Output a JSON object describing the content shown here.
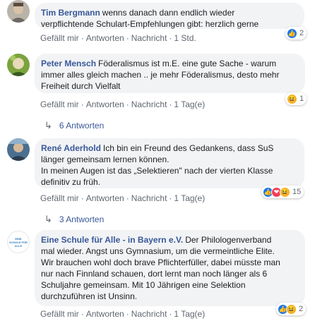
{
  "comments": [
    {
      "author": "Tim Bergmann",
      "lines": [
        "wenns danach dann endlich wieder",
        "verpflichtende Schulart-Empfehlungen gibt: herzlich gerne"
      ],
      "actions": {
        "like": "Gefällt mir",
        "reply": "Antworten",
        "message": "Nachricht",
        "time": "1 Std."
      },
      "reactions": {
        "count": "2"
      }
    },
    {
      "author": "Peter Mensch",
      "lines": [
        "Föderalismus ist m.E. eine gute Sache - warum",
        "immer alles gleich machen .. je mehr Föderalismus, desto mehr",
        "Freiheit durch Vielfalt"
      ],
      "actions": {
        "like": "Gefällt mir",
        "reply": "Antworten",
        "message": "Nachricht",
        "time": "1 Tag(e)"
      },
      "reactions": {
        "count": "1"
      },
      "replies": "6 Antworten"
    },
    {
      "author": "René Aderhold",
      "lines": [
        "Ich bin ein Freund des Gedankens, dass SuS",
        "länger gemeinsam lernen können.",
        "In meinen Augen ist das „Selektieren\" nach der vierten Klasse",
        "definitiv zu früh."
      ],
      "actions": {
        "like": "Gefällt mir",
        "reply": "Antworten",
        "message": "Nachricht",
        "time": "1 Tag(e)"
      },
      "reactions": {
        "count": "15"
      },
      "replies": "3 Antworten"
    },
    {
      "author": "Eine Schule für Alle - in Bayern e.V.",
      "avatar_text": "EINE SCHULE FÜR ALLE",
      "lines": [
        "Der Philologenverband",
        "mal wieder. Angst uns Gymnasium, um die vermeintliche Elite.",
        "Wir brauchen wohl doch brave Pflichterfüller, dabei müsste man",
        "nur nach Finnland schauen, dort lernt man noch länger als 6",
        "Schuljahre gemeinsam. Mit 10 Jährigen eine Selektion",
        "durchzuführen ist Unsinn."
      ],
      "actions": {
        "like": "Gefällt mir",
        "reply": "Antworten",
        "message": "Nachricht",
        "time": "1 Tag(e)"
      },
      "reactions": {
        "count": "2"
      }
    }
  ],
  "colors": {
    "link": "#385898",
    "bubble": "#f2f3f5",
    "meta": "#606770",
    "like": "#1877f2",
    "love": "#f33e58",
    "haha": "#f7b125"
  },
  "icons": {
    "like": "thumbs-up-icon",
    "love": "heart-icon",
    "haha": "laughing-face-icon",
    "reply_arrow": "reply-arrow-icon"
  }
}
